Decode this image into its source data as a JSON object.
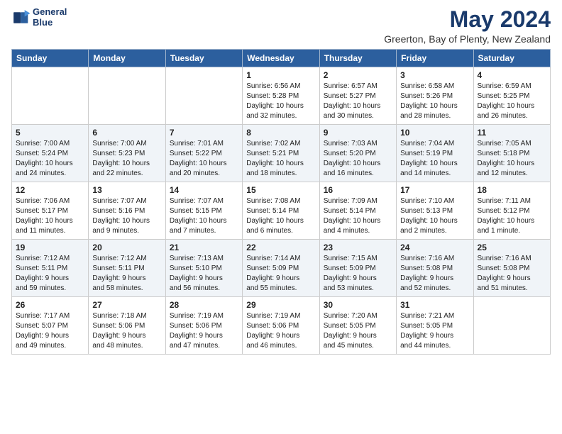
{
  "logo": {
    "line1": "General",
    "line2": "Blue"
  },
  "title": "May 2024",
  "subtitle": "Greerton, Bay of Plenty, New Zealand",
  "days_header": [
    "Sunday",
    "Monday",
    "Tuesday",
    "Wednesday",
    "Thursday",
    "Friday",
    "Saturday"
  ],
  "weeks": [
    [
      {
        "day": "",
        "info": ""
      },
      {
        "day": "",
        "info": ""
      },
      {
        "day": "",
        "info": ""
      },
      {
        "day": "1",
        "info": "Sunrise: 6:56 AM\nSunset: 5:28 PM\nDaylight: 10 hours\nand 32 minutes."
      },
      {
        "day": "2",
        "info": "Sunrise: 6:57 AM\nSunset: 5:27 PM\nDaylight: 10 hours\nand 30 minutes."
      },
      {
        "day": "3",
        "info": "Sunrise: 6:58 AM\nSunset: 5:26 PM\nDaylight: 10 hours\nand 28 minutes."
      },
      {
        "day": "4",
        "info": "Sunrise: 6:59 AM\nSunset: 5:25 PM\nDaylight: 10 hours\nand 26 minutes."
      }
    ],
    [
      {
        "day": "5",
        "info": "Sunrise: 7:00 AM\nSunset: 5:24 PM\nDaylight: 10 hours\nand 24 minutes."
      },
      {
        "day": "6",
        "info": "Sunrise: 7:00 AM\nSunset: 5:23 PM\nDaylight: 10 hours\nand 22 minutes."
      },
      {
        "day": "7",
        "info": "Sunrise: 7:01 AM\nSunset: 5:22 PM\nDaylight: 10 hours\nand 20 minutes."
      },
      {
        "day": "8",
        "info": "Sunrise: 7:02 AM\nSunset: 5:21 PM\nDaylight: 10 hours\nand 18 minutes."
      },
      {
        "day": "9",
        "info": "Sunrise: 7:03 AM\nSunset: 5:20 PM\nDaylight: 10 hours\nand 16 minutes."
      },
      {
        "day": "10",
        "info": "Sunrise: 7:04 AM\nSunset: 5:19 PM\nDaylight: 10 hours\nand 14 minutes."
      },
      {
        "day": "11",
        "info": "Sunrise: 7:05 AM\nSunset: 5:18 PM\nDaylight: 10 hours\nand 12 minutes."
      }
    ],
    [
      {
        "day": "12",
        "info": "Sunrise: 7:06 AM\nSunset: 5:17 PM\nDaylight: 10 hours\nand 11 minutes."
      },
      {
        "day": "13",
        "info": "Sunrise: 7:07 AM\nSunset: 5:16 PM\nDaylight: 10 hours\nand 9 minutes."
      },
      {
        "day": "14",
        "info": "Sunrise: 7:07 AM\nSunset: 5:15 PM\nDaylight: 10 hours\nand 7 minutes."
      },
      {
        "day": "15",
        "info": "Sunrise: 7:08 AM\nSunset: 5:14 PM\nDaylight: 10 hours\nand 6 minutes."
      },
      {
        "day": "16",
        "info": "Sunrise: 7:09 AM\nSunset: 5:14 PM\nDaylight: 10 hours\nand 4 minutes."
      },
      {
        "day": "17",
        "info": "Sunrise: 7:10 AM\nSunset: 5:13 PM\nDaylight: 10 hours\nand 2 minutes."
      },
      {
        "day": "18",
        "info": "Sunrise: 7:11 AM\nSunset: 5:12 PM\nDaylight: 10 hours\nand 1 minute."
      }
    ],
    [
      {
        "day": "19",
        "info": "Sunrise: 7:12 AM\nSunset: 5:11 PM\nDaylight: 9 hours\nand 59 minutes."
      },
      {
        "day": "20",
        "info": "Sunrise: 7:12 AM\nSunset: 5:11 PM\nDaylight: 9 hours\nand 58 minutes."
      },
      {
        "day": "21",
        "info": "Sunrise: 7:13 AM\nSunset: 5:10 PM\nDaylight: 9 hours\nand 56 minutes."
      },
      {
        "day": "22",
        "info": "Sunrise: 7:14 AM\nSunset: 5:09 PM\nDaylight: 9 hours\nand 55 minutes."
      },
      {
        "day": "23",
        "info": "Sunrise: 7:15 AM\nSunset: 5:09 PM\nDaylight: 9 hours\nand 53 minutes."
      },
      {
        "day": "24",
        "info": "Sunrise: 7:16 AM\nSunset: 5:08 PM\nDaylight: 9 hours\nand 52 minutes."
      },
      {
        "day": "25",
        "info": "Sunrise: 7:16 AM\nSunset: 5:08 PM\nDaylight: 9 hours\nand 51 minutes."
      }
    ],
    [
      {
        "day": "26",
        "info": "Sunrise: 7:17 AM\nSunset: 5:07 PM\nDaylight: 9 hours\nand 49 minutes."
      },
      {
        "day": "27",
        "info": "Sunrise: 7:18 AM\nSunset: 5:06 PM\nDaylight: 9 hours\nand 48 minutes."
      },
      {
        "day": "28",
        "info": "Sunrise: 7:19 AM\nSunset: 5:06 PM\nDaylight: 9 hours\nand 47 minutes."
      },
      {
        "day": "29",
        "info": "Sunrise: 7:19 AM\nSunset: 5:06 PM\nDaylight: 9 hours\nand 46 minutes."
      },
      {
        "day": "30",
        "info": "Sunrise: 7:20 AM\nSunset: 5:05 PM\nDaylight: 9 hours\nand 45 minutes."
      },
      {
        "day": "31",
        "info": "Sunrise: 7:21 AM\nSunset: 5:05 PM\nDaylight: 9 hours\nand 44 minutes."
      },
      {
        "day": "",
        "info": ""
      }
    ]
  ]
}
